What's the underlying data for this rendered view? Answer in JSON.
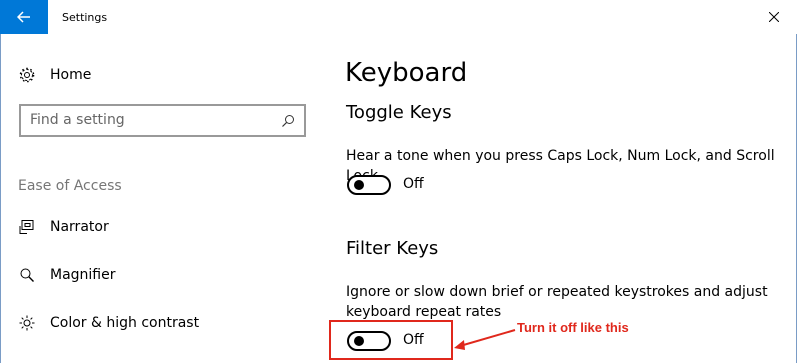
{
  "window": {
    "title": "Settings",
    "back_icon": "arrow-left-icon",
    "close_icon": "close-icon",
    "accent": "#0078d7"
  },
  "sidebar": {
    "home": {
      "label": "Home",
      "icon": "gear-icon"
    },
    "search": {
      "placeholder": "Find a setting",
      "icon": "search-icon"
    },
    "section_header": "Ease of Access",
    "items": [
      {
        "label": "Narrator",
        "icon": "narrator-icon"
      },
      {
        "label": "Magnifier",
        "icon": "magnifier-icon"
      },
      {
        "label": "Color & high contrast",
        "icon": "brightness-icon"
      }
    ]
  },
  "main": {
    "title": "Keyboard",
    "toggle_keys": {
      "heading": "Toggle Keys",
      "description": "Hear a tone when you press Caps Lock, Num Lock, and Scroll Lock",
      "state_label": "Off"
    },
    "filter_keys": {
      "heading": "Filter Keys",
      "description_line1": "Ignore or slow down brief or repeated keystrokes and adjust",
      "description_line2": "keyboard repeat rates",
      "state_label": "Off"
    }
  },
  "annotation": {
    "text": "Turn it off like this",
    "color": "#e0281c"
  }
}
